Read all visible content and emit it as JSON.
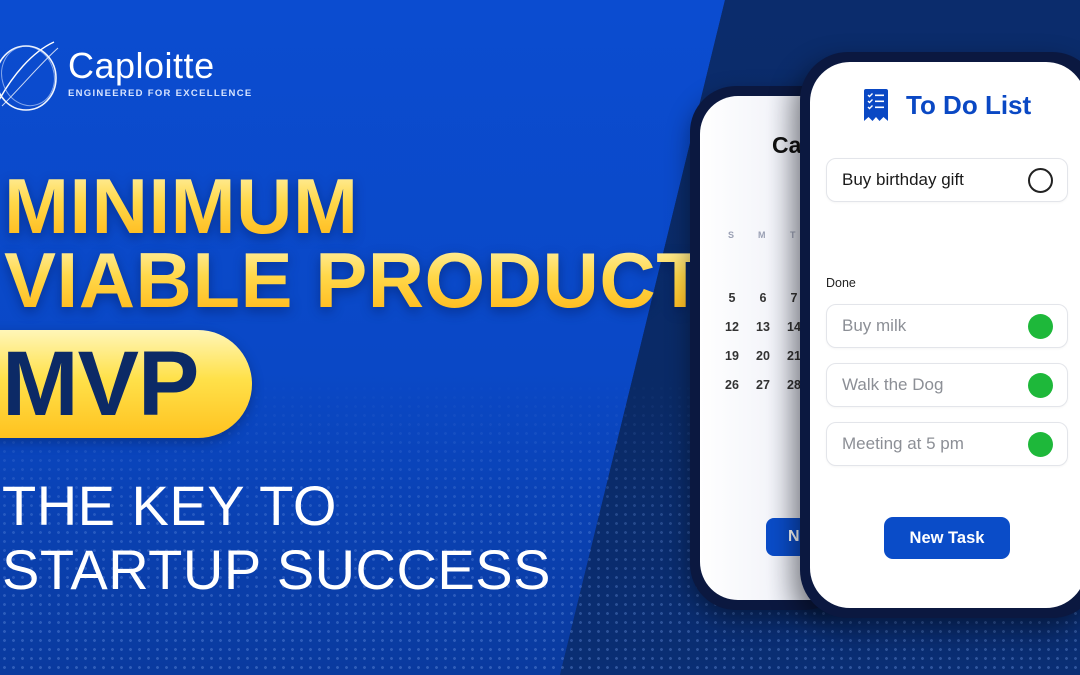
{
  "brand": {
    "name": "Caploitte",
    "tagline": "ENGINEERED FOR EXCELLENCE",
    "logo_icon": "orbit-ring-icon"
  },
  "headline": {
    "line1": "MINIMUM",
    "line2": "VIABLE PRODUCT",
    "acronym": "MVP",
    "subtitle_line1": "THE KEY TO",
    "subtitle_line2": "STARTUP SUCCESS"
  },
  "colors": {
    "background_blue": "#0b4cd0",
    "background_navy": "#0a2a66",
    "headline_gold": "#ffc21f",
    "mvp_text": "#0c2a66",
    "accent_button": "#0a4cc8",
    "done_green": "#1eb83a"
  },
  "calendar_phone": {
    "title_partial": "Ca",
    "weekdays": [
      "S",
      "M",
      "T"
    ],
    "weeks": [
      [
        "5",
        "6",
        "7"
      ],
      [
        "12",
        "13",
        "14"
      ],
      [
        "19",
        "20",
        "21"
      ],
      [
        "26",
        "27",
        "28"
      ]
    ],
    "button_partial": "N"
  },
  "todo_phone": {
    "title": "To Do List",
    "title_icon": "checklist-receipt-icon",
    "open_tasks": [
      {
        "label": "Buy birthday gift",
        "done": false
      }
    ],
    "done_section_label": "Done",
    "done_tasks": [
      {
        "label": "Buy milk",
        "done": true
      },
      {
        "label": "Walk the Dog",
        "done": true
      },
      {
        "label": "Meeting at 5 pm",
        "done": true
      }
    ],
    "new_task_button": "New Task"
  }
}
